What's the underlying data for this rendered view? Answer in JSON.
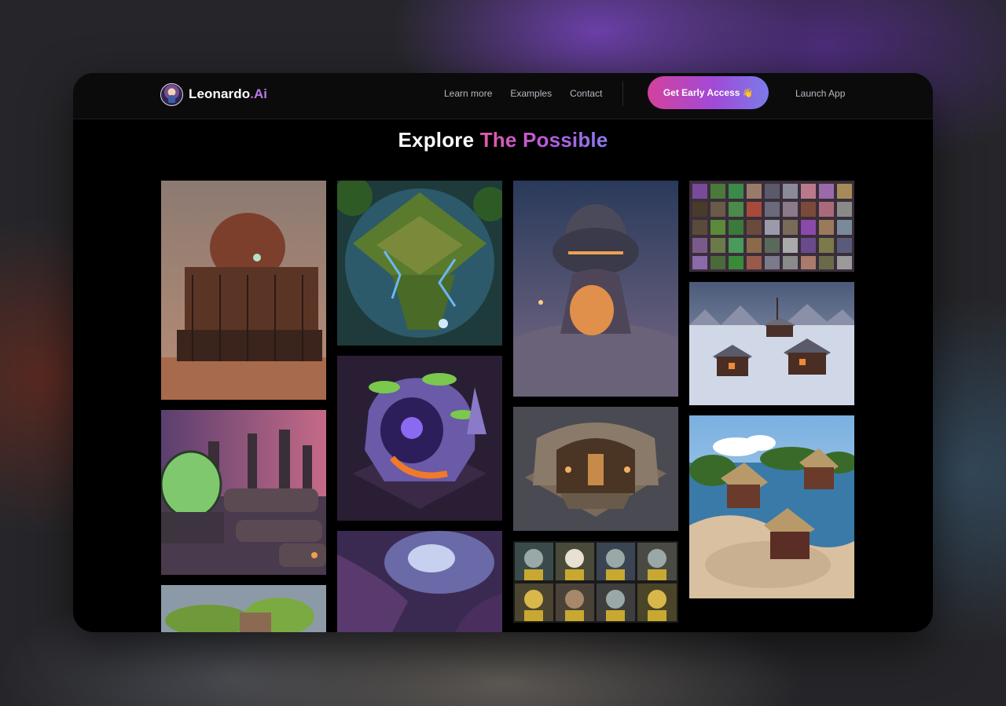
{
  "brand": {
    "name": "Leonardo",
    "dot": ".",
    "suffix": "Ai",
    "logo_icon": "leonardo-portrait-logo-icon"
  },
  "nav": {
    "links": [
      "Learn more",
      "Examples",
      "Contact"
    ],
    "cta_label": "Get Early Access",
    "cta_icon": "👋",
    "launch_label": "Launch App"
  },
  "heading": {
    "part1": "Explore",
    "part2": "The Possible"
  },
  "gallery": {
    "images": [
      "steampunk-dome-building-image",
      "isometric-jungle-temple-image",
      "sci-fi-dome-structure-image",
      "pixel-character-portraits-grid-image",
      "purple-crystal-cave-diorama-image",
      "industrial-green-dome-factory-image",
      "stone-ruins-diorama-image",
      "snowy-village-cabins-image",
      "cat-character-portraits-image",
      "island-huts-village-image",
      "green-floating-island-image",
      "swirling-cosmic-cavern-image"
    ]
  },
  "colors": {
    "accent_pink": "#d4419c",
    "accent_purple": "#a14ad8",
    "accent_blue": "#7b7be8"
  }
}
